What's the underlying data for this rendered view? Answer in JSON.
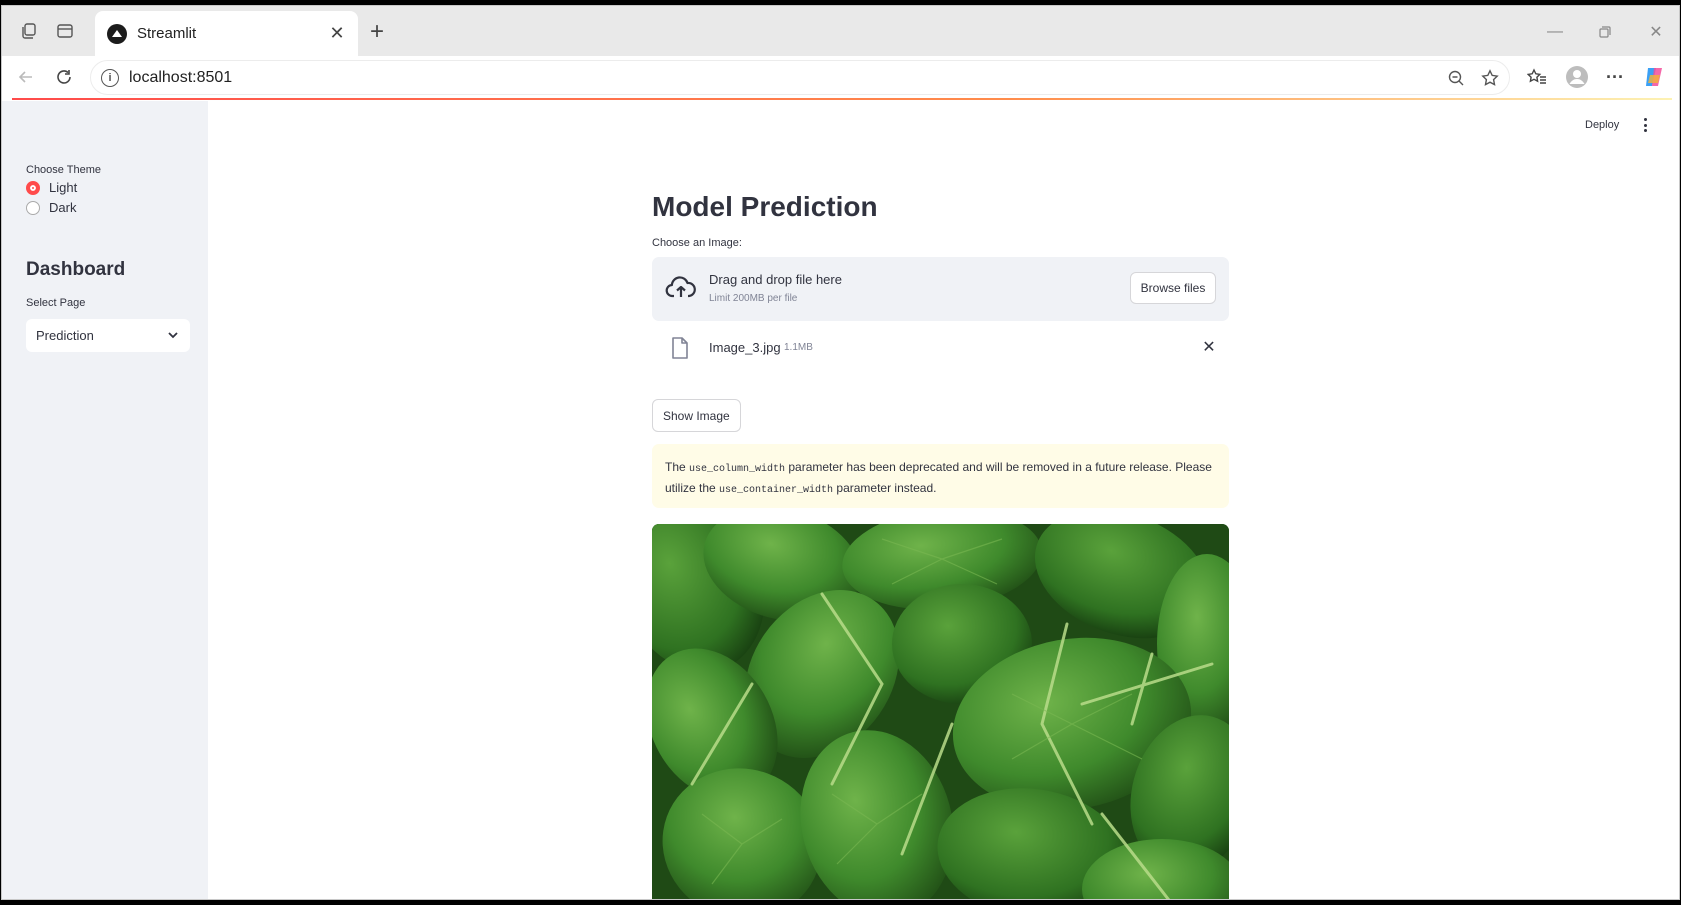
{
  "browser": {
    "tab_title": "Streamlit",
    "url": "localhost:8501"
  },
  "sidebar": {
    "theme_label": "Choose Theme",
    "theme_options": [
      {
        "label": "Light",
        "selected": true
      },
      {
        "label": "Dark",
        "selected": false
      }
    ],
    "title": "Dashboard",
    "page_label": "Select Page",
    "page_value": "Prediction"
  },
  "header": {
    "deploy_label": "Deploy"
  },
  "main": {
    "title": "Model Prediction",
    "upload_label": "Choose an Image:",
    "dropzone_text": "Drag and drop file here",
    "dropzone_limit": "Limit 200MB per file",
    "browse_label": "Browse files",
    "file_name": "Image_3.jpg",
    "file_size": "1.1MB",
    "show_button": "Show Image",
    "warning": {
      "part1": "The ",
      "code1": "use_column_width",
      "part2": " parameter has been deprecated and will be removed in a future release. Please utilize the ",
      "code2": "use_container_width",
      "part3": " parameter instead."
    }
  },
  "colors": {
    "accent": "#ff4b4b",
    "sidebar_bg": "#f0f2f6",
    "warning_bg": "#fffce7",
    "leaf_green": "#3f8a2c"
  }
}
